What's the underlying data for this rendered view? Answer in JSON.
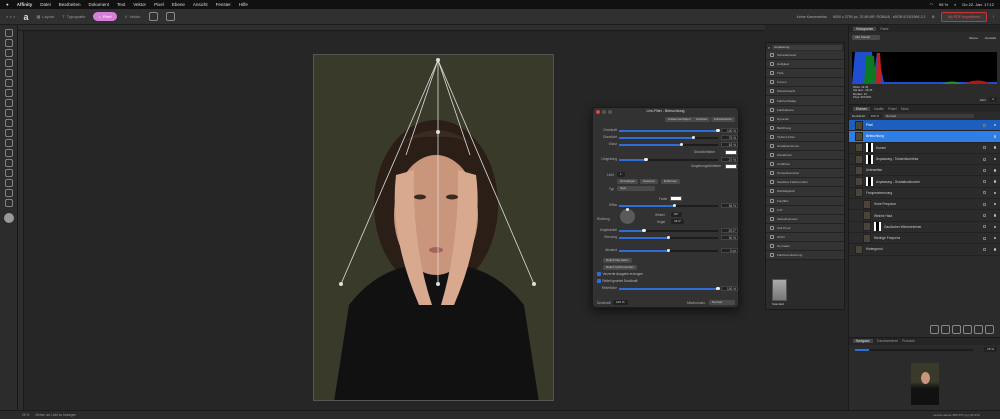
{
  "menubar": {
    "app": "Affinity",
    "items": [
      "Datei",
      "Bearbeiten",
      "Dokument",
      "Text",
      "Vektor",
      "Pixel",
      "Ebene",
      "Ansicht",
      "Fenster",
      "Hilfe"
    ],
    "battery": "95 %",
    "datetime": "Do 22. Jan. 17:12"
  },
  "toolbar": {
    "personas": [
      "Layout",
      "Typografie",
      "Pixel",
      "Vektor"
    ],
    "active_persona": "Pixel",
    "doc_label": "Keine Kamerainfos",
    "doc_info": "6000 x 3750 px, 32.86 MP, RGBA/8 - sRGB IEC61966-2.1",
    "export_label": "Als PDF exportieren",
    "accent": "#d77ed8"
  },
  "dialog": {
    "title": "Live-Filter - Beleuchtung",
    "buttons": [
      "Zusammenfügen",
      "Löschen",
      "Zurücksetzen"
    ],
    "sliders1": [
      {
        "label": "Deckkraft",
        "value": "100 %",
        "pct": 100
      },
      {
        "label": "Glanzlicht",
        "value": "75 %",
        "pct": 75
      },
      {
        "label": "Glanz",
        "value": "63 %",
        "pct": 63
      }
    ],
    "specular_color_label": "Glanzlichtfarbe",
    "ambient": {
      "label": "Umgebung",
      "value": "27 %",
      "pct": 27
    },
    "ambient_color_label": "Umgebungslichtfarbe",
    "light_label": "Licht",
    "light_number": "1",
    "light_buttons": [
      "Hinzufügen",
      "Kopieren",
      "Entfernen"
    ],
    "type_label": "Typ",
    "type_value": "Spot",
    "color_label": "Farbe",
    "diffuse": {
      "label": "Diffus",
      "value": "56 %",
      "pct": 56
    },
    "direction_label": "Richtung",
    "angle_label": "Winkel",
    "angle_value": "60°",
    "cone_label": "Kegel",
    "cone_value": "46.0°",
    "sliders2": [
      {
        "label": "Kegelwinkel",
        "value": "25.0°",
        "pct": 25
      },
      {
        "label": "Streuung",
        "value": "50 %",
        "pct": 50
      }
    ],
    "distance": {
      "label": "Abstand",
      "value": "0 px",
      "pct": 50
    },
    "bump_buttons": [
      "Relief links laden",
      "Relief rechts löschen"
    ],
    "checks": [
      "Verzerrte Ausgabe erzeugen",
      "Relief ignoriert Deckkraft"
    ],
    "height": {
      "label": "Reliefhöhe",
      "value": "100 %",
      "pct": 100
    },
    "opacity_label": "Deckkraft",
    "opacity_value": "100 %",
    "blend_label": "Mischmodus",
    "blend_value": "Normal"
  },
  "adjustments": {
    "filter": "Anpassung",
    "items": [
      "Schwellenwert",
      "Helligkeit",
      "Tiefe",
      "Kurven",
      "Schwarzweiß",
      "Farbton/Sättig.",
      "Farbbalance",
      "Dynamik",
      "Belichtung",
      "Tiefen/Lichter",
      "Gradationskurve",
      "Kanalmixer",
      "Umfärben",
      "Tonwertkorrektur",
      "Selektive Farbkorrektur",
      "Weißabgleich",
      "Fotofilter",
      "LUT",
      "Verlaufsumsetz.",
      "Soft Proof",
      "OCIO",
      "Normalen",
      "Farbtonumkehrung"
    ],
    "preset_label": "Standard"
  },
  "histogram": {
    "tabs": [
      "Histogramm",
      "Farbe"
    ],
    "channel": "Alle Kanäle",
    "options": [
      "Ebene",
      "Auswahl"
    ],
    "stats": [
      "Mittel: 44.35",
      "Std.abw.: 48.45",
      "Median: 24",
      "Pixel: 6972451"
    ],
    "level_label": "Wert",
    "level_value": "0"
  },
  "layers": {
    "tabs": [
      "Ebenen",
      "Kanäle",
      "Pinsel",
      "Stock"
    ],
    "opacity_label": "Deckkraft:",
    "opacity": "100 %",
    "blend": "Normal",
    "items": [
      {
        "name": "Pixel",
        "sel": "a"
      },
      {
        "name": "Beleuchtung",
        "sel": "b"
      },
      {
        "name": "Kurven"
      },
      {
        "name": "Anpassung - Tonwertkorrektur"
      },
      {
        "name": "Unterseiten"
      },
      {
        "name": "Anpassung - Gradationskurven"
      },
      {
        "name": "Frequenztrennung"
      },
      {
        "name": "Hohe Frequenz"
      },
      {
        "name": "Weiche Haut"
      },
      {
        "name": "Gaußscher Weichzeichner"
      },
      {
        "name": "Niedrige Frequenz"
      },
      {
        "name": "Hintergrund"
      }
    ]
  },
  "navigator": {
    "tabs": [
      "Navigator",
      "Transformieren",
      "Protokoll"
    ],
    "zoom": "25 %",
    "filename": "people-daniel-4657157.jpg (25.9%)"
  },
  "statusbar": {
    "zoom": "25 %",
    "hint": "Ziehen um Licht zu bewegen"
  }
}
